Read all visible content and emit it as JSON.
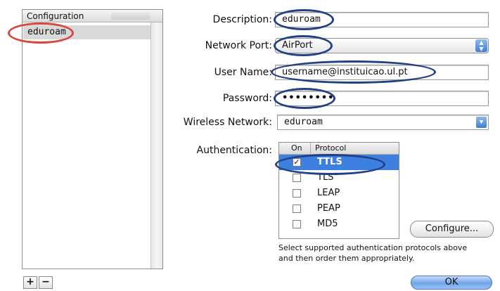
{
  "config_list": {
    "header": "Configuration",
    "items": [
      {
        "label": "eduroam",
        "selected": true
      }
    ],
    "add_label": "+",
    "remove_label": "−"
  },
  "form": {
    "description": {
      "label": "Description:",
      "value": "eduroam"
    },
    "network_port": {
      "label": "Network Port:",
      "value": "AirPort"
    },
    "user_name": {
      "label": "User Name:",
      "value": "username@instituicao.ul.pt"
    },
    "password": {
      "label": "Password:",
      "value": "••••••••"
    },
    "wireless_network": {
      "label": "Wireless Network:",
      "value": "eduroam"
    },
    "authentication": {
      "label": "Authentication:",
      "columns": [
        "On",
        "Protocol"
      ],
      "rows": [
        {
          "protocol": "TTLS",
          "checked": true,
          "selected": true,
          "check_mark": "✓"
        },
        {
          "protocol": "TLS",
          "checked": false,
          "selected": false,
          "check_mark": ""
        },
        {
          "protocol": "LEAP",
          "checked": false,
          "selected": false,
          "check_mark": ""
        },
        {
          "protocol": "PEAP",
          "checked": false,
          "selected": false,
          "check_mark": ""
        },
        {
          "protocol": "MD5",
          "checked": false,
          "selected": false,
          "check_mark": ""
        }
      ]
    },
    "configure_button": "Configure...",
    "hint_line1": "Select supported authentication protocols above",
    "hint_line2": "and then order them appropriately.",
    "ok_button": "OK"
  },
  "colors": {
    "highlight_red": "#d9463b",
    "highlight_blue": "#233f86",
    "selection_blue": "#3d80df"
  },
  "icons": {
    "popup_stepper": "up-down-arrows-icon",
    "combo_arrow": "chevron-down-icon"
  }
}
